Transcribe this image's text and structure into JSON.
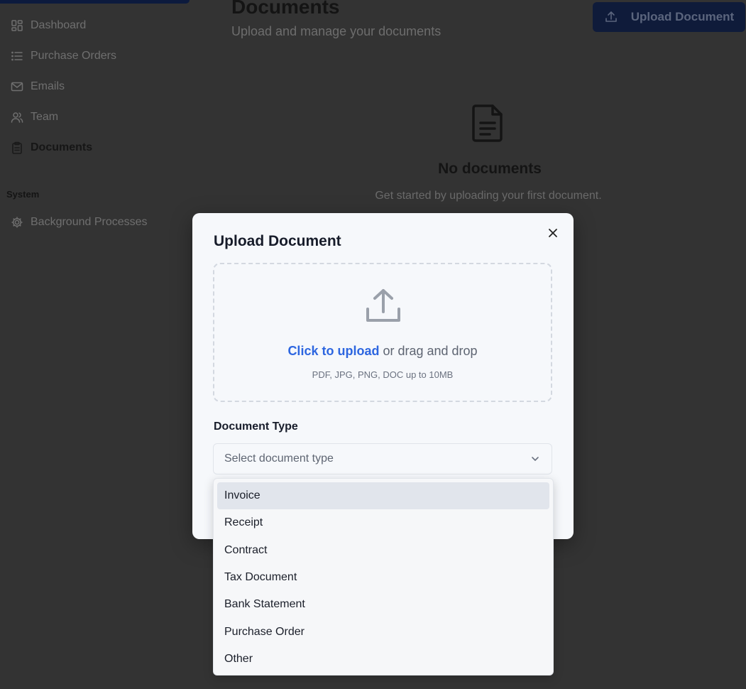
{
  "sidebar": {
    "items": [
      {
        "label": "Dashboard",
        "icon": "dashboard-icon"
      },
      {
        "label": "Purchase Orders",
        "icon": "list-icon"
      },
      {
        "label": "Emails",
        "icon": "mail-icon"
      },
      {
        "label": "Team",
        "icon": "users-icon"
      },
      {
        "label": "Documents",
        "icon": "clipboard-icon",
        "active": true
      }
    ],
    "section_label": "System",
    "system_items": [
      {
        "label": "Background Processes",
        "icon": "gear-icon"
      }
    ]
  },
  "header": {
    "title": "Documents",
    "subtitle": "Upload and manage your documents",
    "upload_button_label": "Upload Document"
  },
  "empty_state": {
    "title": "No documents",
    "subtitle": "Get started by uploading your first document."
  },
  "modal": {
    "title": "Upload Document",
    "dropzone": {
      "link_text": "Click to upload",
      "rest_text": " or drag and drop",
      "hint": "PDF, JPG, PNG, DOC up to 10MB"
    },
    "document_type": {
      "label": "Document Type",
      "placeholder": "Select document type",
      "options": [
        "Invoice",
        "Receipt",
        "Contract",
        "Tax Document",
        "Bank Statement",
        "Purchase Order",
        "Other"
      ],
      "highlighted": "Invoice"
    }
  },
  "colors": {
    "overlay_bg": "#333333",
    "accent_link": "#2d66e0",
    "top_button_bg": "#0f1b3a",
    "modal_bg": "#f6f8fb",
    "option_highlight": "#e1e5ec"
  }
}
